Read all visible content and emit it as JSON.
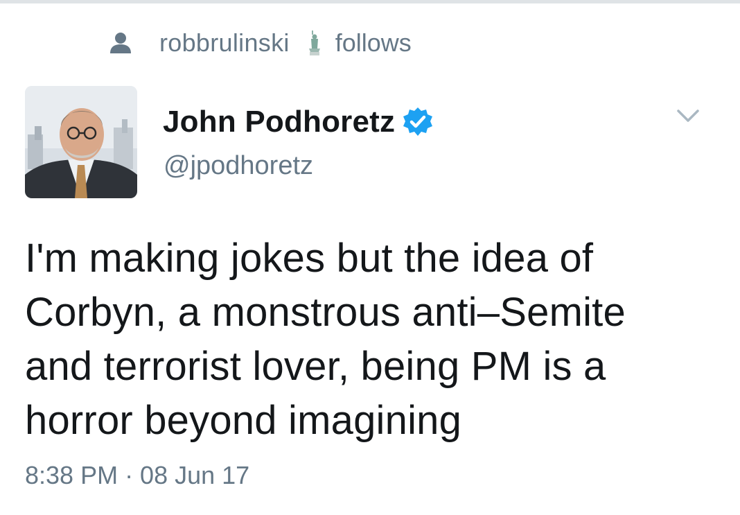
{
  "social_context": {
    "icon": "person-icon",
    "username": "robbrulinski",
    "badge_icon": "statue-icon",
    "action": "follows"
  },
  "tweet": {
    "avatar_icon": "profile-photo",
    "display_name": "John Podhoretz",
    "verified": true,
    "verified_color": "#1da1f2",
    "handle": "@jpodhoretz",
    "text": "I'm making jokes but the idea of\nCorbyn, a monstrous anti–Semite\nand terrorist lover, being PM is a\nhorror beyond imagining",
    "timestamp": "8:38 PM · 08 Jun 17",
    "menu_icon": "chevron-down-icon"
  },
  "colors": {
    "primary_text": "#14171a",
    "secondary_text": "#657786",
    "divider": "#dfe3e6"
  }
}
